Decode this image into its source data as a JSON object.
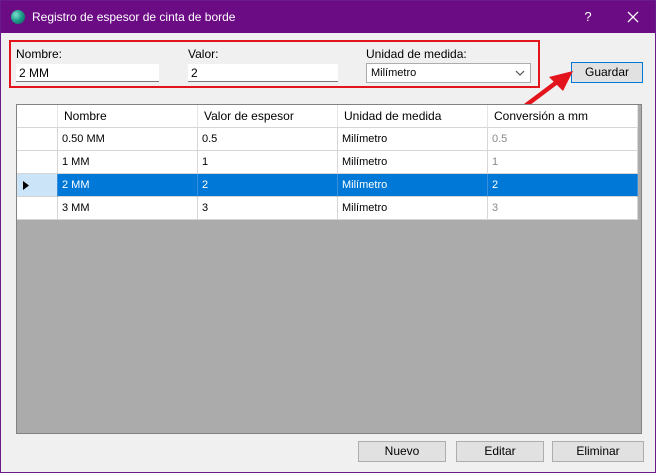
{
  "window": {
    "title": "Registro de espesor de cinta de borde",
    "help": "?",
    "icon": "app-globe-icon"
  },
  "form": {
    "nombre_label": "Nombre:",
    "nombre_value": "2 MM",
    "valor_label": "Valor:",
    "valor_value": "2",
    "unidad_label": "Unidad de medida:",
    "unidad_value": "Milímetro"
  },
  "buttons": {
    "guardar": "Guardar",
    "nuevo": "Nuevo",
    "editar": "Editar",
    "eliminar": "Eliminar"
  },
  "grid": {
    "columns": [
      "Nombre",
      "Valor de espesor",
      "Unidad de medida",
      "Conversión a mm"
    ],
    "rows": [
      {
        "nombre": "0.50 MM",
        "valor": "0.5",
        "unidad": "Milímetro",
        "conversion": "0.5",
        "selected": false
      },
      {
        "nombre": "1 MM",
        "valor": "1",
        "unidad": "Milímetro",
        "conversion": "1",
        "selected": false
      },
      {
        "nombre": "2 MM",
        "valor": "2",
        "unidad": "Milímetro",
        "conversion": "2",
        "selected": true
      },
      {
        "nombre": "3 MM",
        "valor": "3",
        "unidad": "Milímetro",
        "conversion": "3",
        "selected": false
      }
    ]
  },
  "colors": {
    "titlebar": "#6b0c85",
    "selection": "#0078d7",
    "annotation": "#e3141b"
  }
}
